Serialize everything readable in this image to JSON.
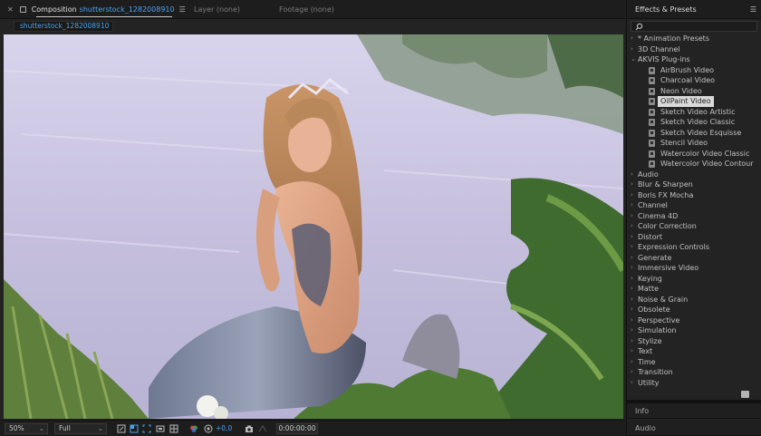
{
  "composition": {
    "tab_label": "Composition",
    "comp_name": "shutterstock_1282008910",
    "layer_tab": "Layer (none)",
    "footage_tab": "Footage (none)",
    "subtab": "shutterstock_1282008910"
  },
  "toolbar": {
    "zoom": "50%",
    "resolution": "Full",
    "exposure": "+0,0",
    "timecode": "0:00:00:00"
  },
  "effects_panel": {
    "title": "Effects & Presets",
    "search_placeholder": "",
    "items": [
      {
        "label": "* Animation Presets",
        "expanded": false
      },
      {
        "label": "3D Channel",
        "expanded": false
      },
      {
        "label": "AKVIS Plug-ins",
        "expanded": true
      },
      {
        "label": "AirBrush Video",
        "child": true
      },
      {
        "label": "Charcoal Video",
        "child": true
      },
      {
        "label": "Neon Video",
        "child": true
      },
      {
        "label": "OilPaint Video",
        "child": true,
        "selected": true
      },
      {
        "label": "Sketch Video Artistic",
        "child": true
      },
      {
        "label": "Sketch Video Classic",
        "child": true
      },
      {
        "label": "Sketch Video Esquisse",
        "child": true
      },
      {
        "label": "Stencil Video",
        "child": true
      },
      {
        "label": "Watercolor Video Classic",
        "child": true
      },
      {
        "label": "Watercolor Video Contour",
        "child": true
      },
      {
        "label": "Audio",
        "expanded": false
      },
      {
        "label": "Blur & Sharpen",
        "expanded": false
      },
      {
        "label": "Boris FX Mocha",
        "expanded": false
      },
      {
        "label": "Channel",
        "expanded": false
      },
      {
        "label": "Cinema 4D",
        "expanded": false
      },
      {
        "label": "Color Correction",
        "expanded": false
      },
      {
        "label": "Distort",
        "expanded": false
      },
      {
        "label": "Expression Controls",
        "expanded": false
      },
      {
        "label": "Generate",
        "expanded": false
      },
      {
        "label": "Immersive Video",
        "expanded": false
      },
      {
        "label": "Keying",
        "expanded": false
      },
      {
        "label": "Matte",
        "expanded": false
      },
      {
        "label": "Noise & Grain",
        "expanded": false
      },
      {
        "label": "Obsolete",
        "expanded": false
      },
      {
        "label": "Perspective",
        "expanded": false
      },
      {
        "label": "Simulation",
        "expanded": false
      },
      {
        "label": "Stylize",
        "expanded": false
      },
      {
        "label": "Text",
        "expanded": false
      },
      {
        "label": "Time",
        "expanded": false
      },
      {
        "label": "Transition",
        "expanded": false
      },
      {
        "label": "Utility",
        "expanded": false
      }
    ]
  },
  "info_panel": {
    "title": "Info"
  },
  "audio_panel": {
    "title": "Audio"
  },
  "colors": {
    "accent": "#4aa3f0",
    "panel_bg": "#232323",
    "selected_bg": "#d9d9d9"
  }
}
